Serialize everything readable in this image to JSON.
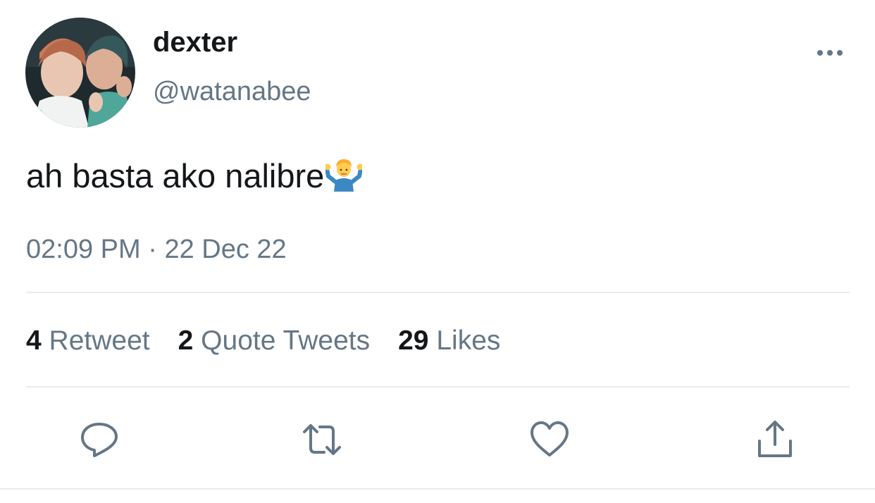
{
  "tweet": {
    "display_name": "dexter",
    "handle": "@watanabee",
    "text": "ah basta ako nalibre",
    "emoji": "man-shrugging-icon",
    "time": "02:09 PM",
    "separator": "·",
    "date": "22 Dec 22"
  },
  "stats": {
    "retweets_count": "4",
    "retweets_label": "Retweet",
    "quotes_count": "2",
    "quotes_label": "Quote Tweets",
    "likes_count": "29",
    "likes_label": "Likes"
  },
  "icons": {
    "more": "more-horizontal-icon",
    "reply": "reply-icon",
    "retweet": "retweet-icon",
    "like": "heart-icon",
    "share": "share-icon"
  },
  "colors": {
    "text_primary": "#14171a",
    "text_secondary": "#657786",
    "divider": "#e6ecf0"
  }
}
